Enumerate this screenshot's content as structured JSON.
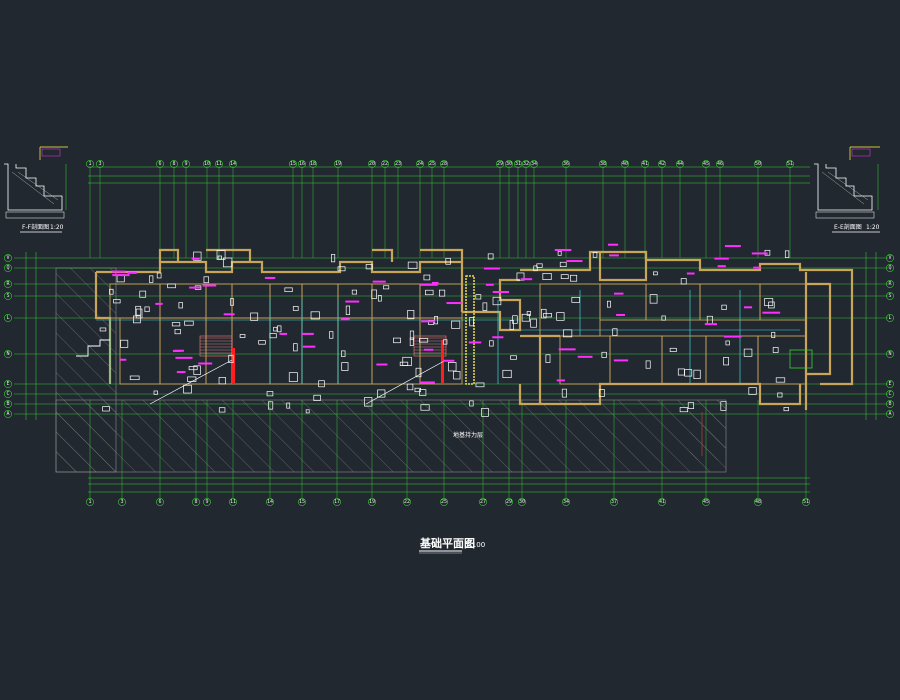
{
  "drawing": {
    "title": "基础平面图",
    "scale": "1:100",
    "detail_left_title": "F-F剖面图",
    "detail_left_scale": "1:20",
    "detail_right_title": "E-E剖面图",
    "detail_right_scale": "1:20",
    "hatch_label": "地基持力层",
    "axes_top": [
      "1",
      "3",
      "6",
      "8",
      "9",
      "10",
      "11",
      "14",
      "15",
      "16",
      "18",
      "19",
      "20",
      "22",
      "23",
      "24",
      "25",
      "28",
      "29",
      "30",
      "31",
      "32",
      "34",
      "36",
      "38",
      "40",
      "41",
      "42",
      "44",
      "45",
      "46",
      "50",
      "51"
    ],
    "axes_bottom": [
      "1",
      "3",
      "6",
      "8",
      "9",
      "11",
      "14",
      "15",
      "17",
      "19",
      "22",
      "25",
      "27",
      "29",
      "30",
      "34",
      "37",
      "41",
      "45",
      "48",
      "51"
    ],
    "axes_left": [
      "V",
      "Q",
      "R",
      "S",
      "L",
      "N",
      "E",
      "C",
      "B",
      "A"
    ],
    "axes_right": [
      "V",
      "Q",
      "R",
      "S",
      "L",
      "N",
      "E",
      "C",
      "B",
      "A"
    ]
  },
  "colors": {
    "background": "#212830",
    "grid": "#39d42f",
    "wall": "#c9a55a",
    "column": "#ffffff",
    "annotation": "#ff2dff",
    "cyan": "#3fd6d6",
    "hatch": "#7d7d7d",
    "red": "#ff1f1f"
  }
}
